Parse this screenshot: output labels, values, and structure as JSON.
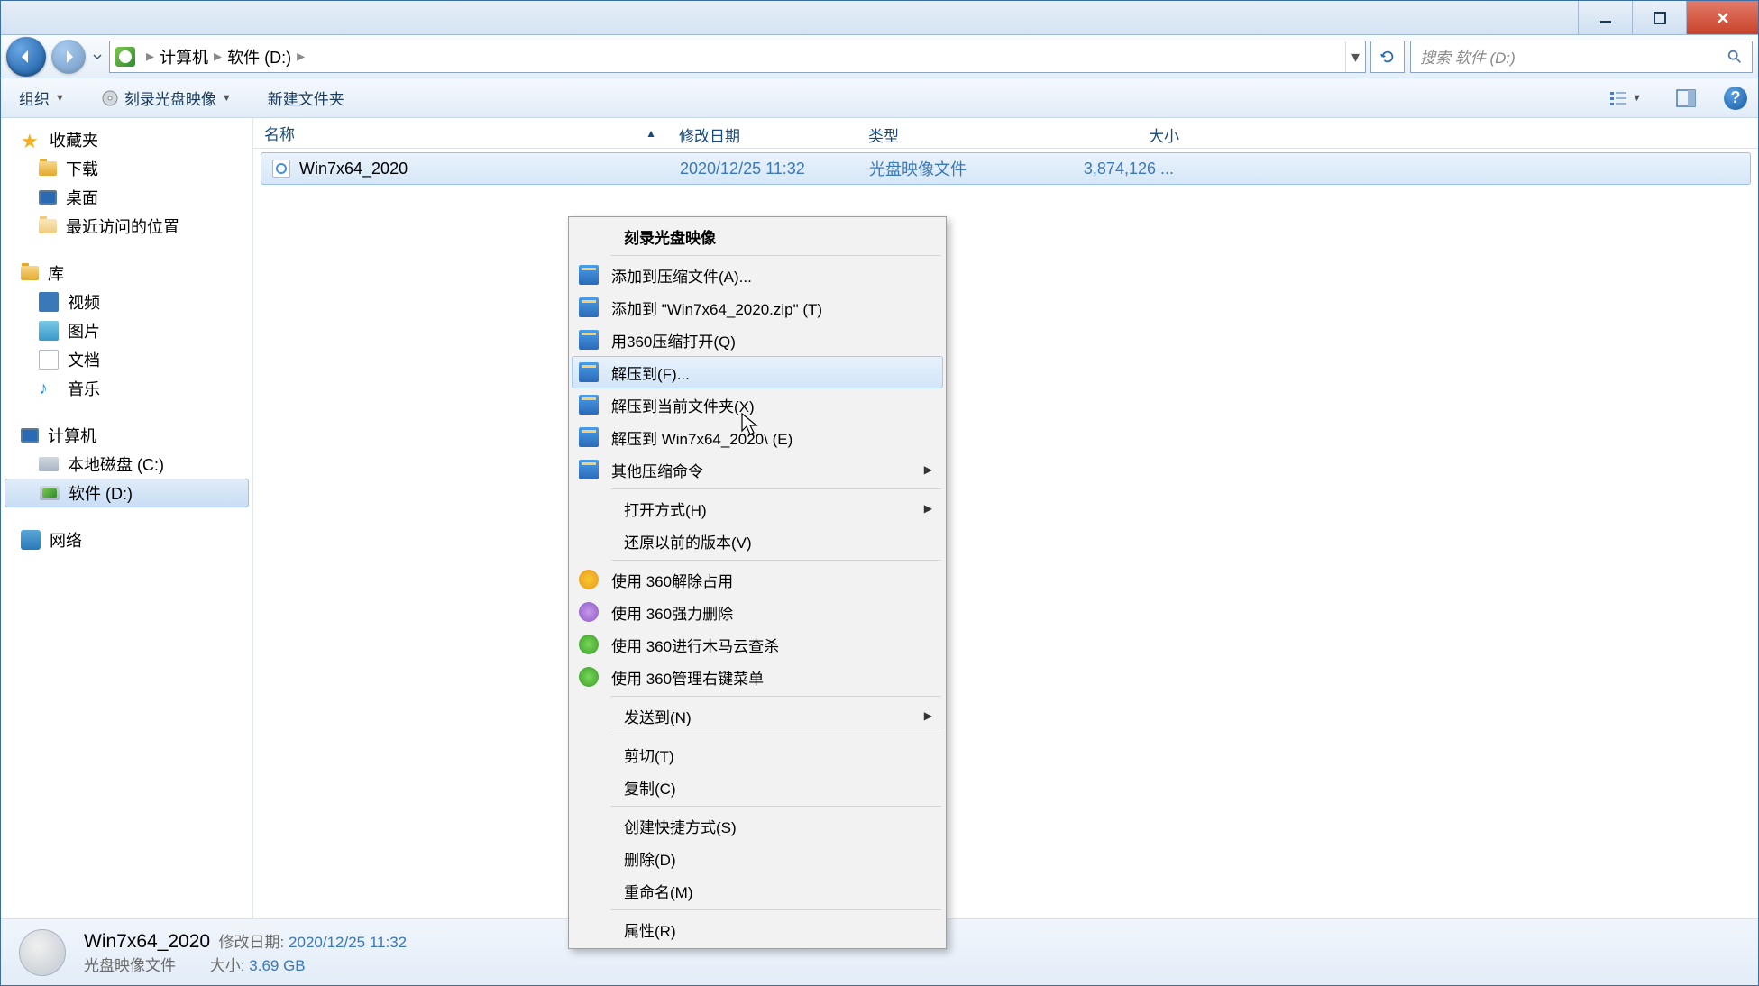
{
  "breadcrumb": {
    "root": "计算机",
    "current": "软件 (D:)"
  },
  "search": {
    "placeholder": "搜索 软件 (D:)"
  },
  "toolbar": {
    "organize": "组织",
    "burn": "刻录光盘映像",
    "newfolder": "新建文件夹"
  },
  "sidebar": {
    "favorites": {
      "head": "收藏夹",
      "items": [
        "下载",
        "桌面",
        "最近访问的位置"
      ]
    },
    "libraries": {
      "head": "库",
      "items": [
        "视频",
        "图片",
        "文档",
        "音乐"
      ]
    },
    "computer": {
      "head": "计算机",
      "items": [
        "本地磁盘 (C:)",
        "软件 (D:)"
      ]
    },
    "network": {
      "head": "网络"
    }
  },
  "columns": {
    "name": "名称",
    "date": "修改日期",
    "type": "类型",
    "size": "大小"
  },
  "file": {
    "name": "Win7x64_2020",
    "date": "2020/12/25 11:32",
    "type": "光盘映像文件",
    "size": "3,874,126 ..."
  },
  "contextmenu": {
    "burn": "刻录光盘映像",
    "addToArchive": "添加到压缩文件(A)...",
    "addToZip": "添加到 \"Win7x64_2020.zip\" (T)",
    "openWith360zip": "用360压缩打开(Q)",
    "extractTo": "解压到(F)...",
    "extractHere": "解压到当前文件夹(X)",
    "extractToFolder": "解压到 Win7x64_2020\\ (E)",
    "otherZip": "其他压缩命令",
    "openWith": "打开方式(H)",
    "restorePrev": "还原以前的版本(V)",
    "use360unlock": "使用 360解除占用",
    "use360force": "使用 360强力删除",
    "use360scan": "使用 360进行木马云查杀",
    "use360menu": "使用 360管理右键菜单",
    "sendTo": "发送到(N)",
    "cut": "剪切(T)",
    "copy": "复制(C)",
    "shortcut": "创建快捷方式(S)",
    "delete": "删除(D)",
    "rename": "重命名(M)",
    "properties": "属性(R)"
  },
  "details": {
    "name": "Win7x64_2020",
    "type": "光盘映像文件",
    "dateLabel": "修改日期:",
    "date": "2020/12/25 11:32",
    "sizeLabel": "大小:",
    "size": "3.69 GB"
  }
}
